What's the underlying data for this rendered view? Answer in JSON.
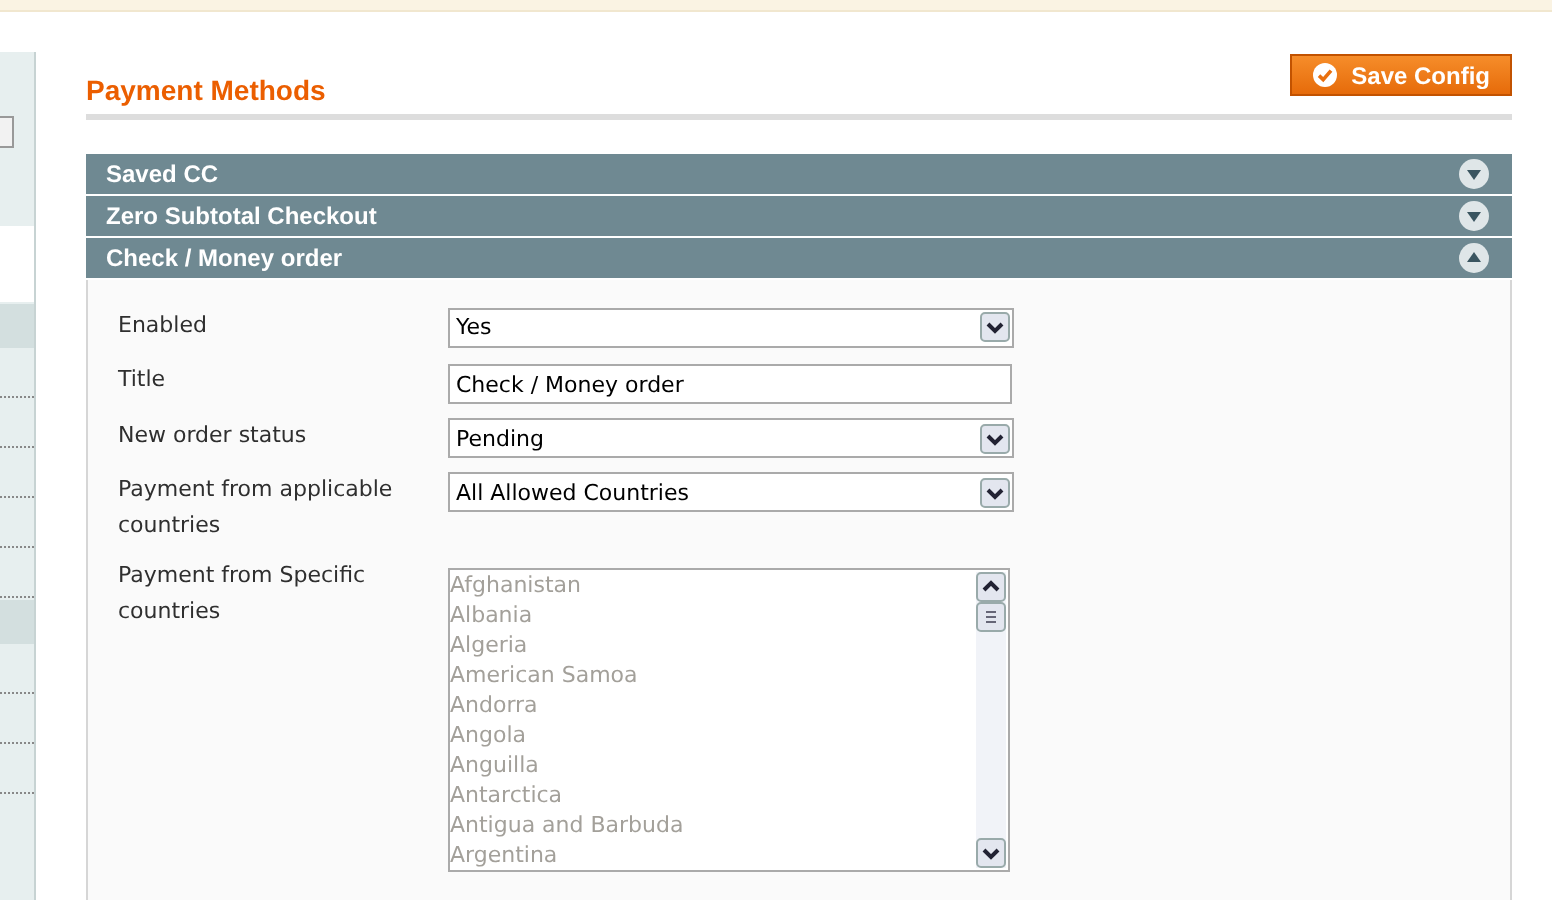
{
  "page_title": "Payment Methods",
  "save_button": "Save Config",
  "sections": [
    {
      "title": "Saved CC",
      "expanded": false
    },
    {
      "title": "Zero Subtotal Checkout",
      "expanded": false
    },
    {
      "title": "Check / Money order",
      "expanded": true
    }
  ],
  "fields": [
    {
      "kind": "select",
      "label": "Enabled",
      "value": "Yes"
    },
    {
      "kind": "text",
      "label": "Title",
      "value": "Check / Money order"
    },
    {
      "kind": "select",
      "label": "New order status",
      "value": "Pending"
    },
    {
      "kind": "select",
      "label": "Payment from applicable countries",
      "value": "All Allowed Countries"
    },
    {
      "kind": "multiselect",
      "label": "Payment from Specific countries",
      "disabled": true,
      "options": [
        "Afghanistan",
        "Albania",
        "Algeria",
        "American Samoa",
        "Andorra",
        "Angola",
        "Anguilla",
        "Antarctica",
        "Antigua and Barbuda",
        "Argentina"
      ]
    }
  ]
}
